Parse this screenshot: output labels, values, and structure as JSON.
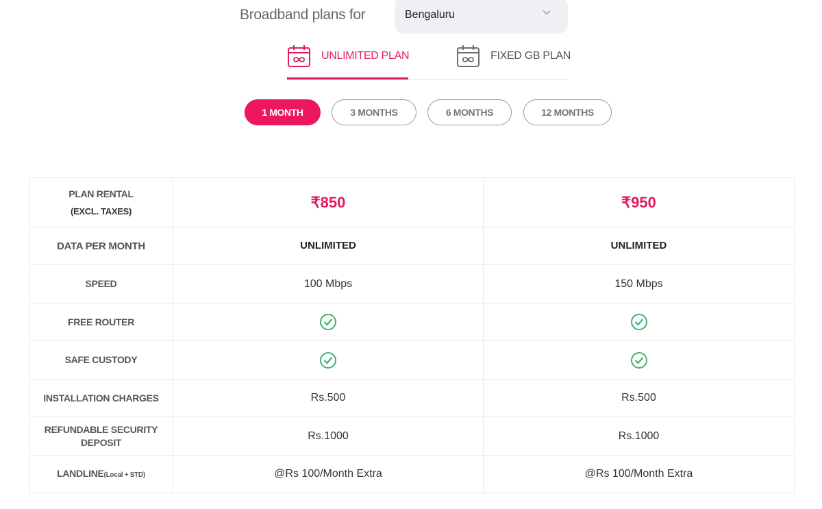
{
  "header": {
    "title": "Broadband plans for",
    "city_select": {
      "value": "Bengaluru"
    }
  },
  "plan_tabs": [
    {
      "label": "UNLIMITED PLAN",
      "icon": "calendar-infinity-icon",
      "active": true
    },
    {
      "label": "FIXED GB PLAN",
      "icon": "calendar-infinity-icon",
      "active": false
    }
  ],
  "durations": [
    {
      "label": "1 MONTH",
      "active": true
    },
    {
      "label": "3 MONTHS",
      "active": false
    },
    {
      "label": "6 MONTHS",
      "active": false
    },
    {
      "label": "12 MONTHS",
      "active": false
    }
  ],
  "table": {
    "rows": {
      "rental": {
        "label": "PLAN RENTAL",
        "sublabel": "(EXCL. TAXES)",
        "values": [
          "₹850",
          "₹950"
        ]
      },
      "data": {
        "label": "DATA PER MONTH",
        "values": [
          "UNLIMITED",
          "UNLIMITED"
        ]
      },
      "speed": {
        "label": "SPEED",
        "values": [
          "100 Mbps",
          "150 Mbps"
        ]
      },
      "router": {
        "label": "FREE ROUTER",
        "values": [
          "check-icon",
          "check-icon"
        ]
      },
      "custody": {
        "label": "SAFE CUSTODY",
        "values": [
          "check-icon",
          "check-icon"
        ]
      },
      "installation": {
        "label": "INSTALLATION CHARGES",
        "values": [
          "Rs.500",
          "Rs.500"
        ]
      },
      "deposit": {
        "label": "REFUNDABLE SECURITY DEPOSIT",
        "values": [
          "Rs.1000",
          "Rs.1000"
        ]
      },
      "landline": {
        "label": "LANDLINE",
        "label_small": "(Local + STD)",
        "values": [
          "@Rs 100/Month Extra",
          "@Rs 100/Month Extra"
        ]
      }
    }
  },
  "colors": {
    "accent": "#e5195e",
    "check": "#3cb371",
    "inactive_border": "#9a9a9a"
  }
}
